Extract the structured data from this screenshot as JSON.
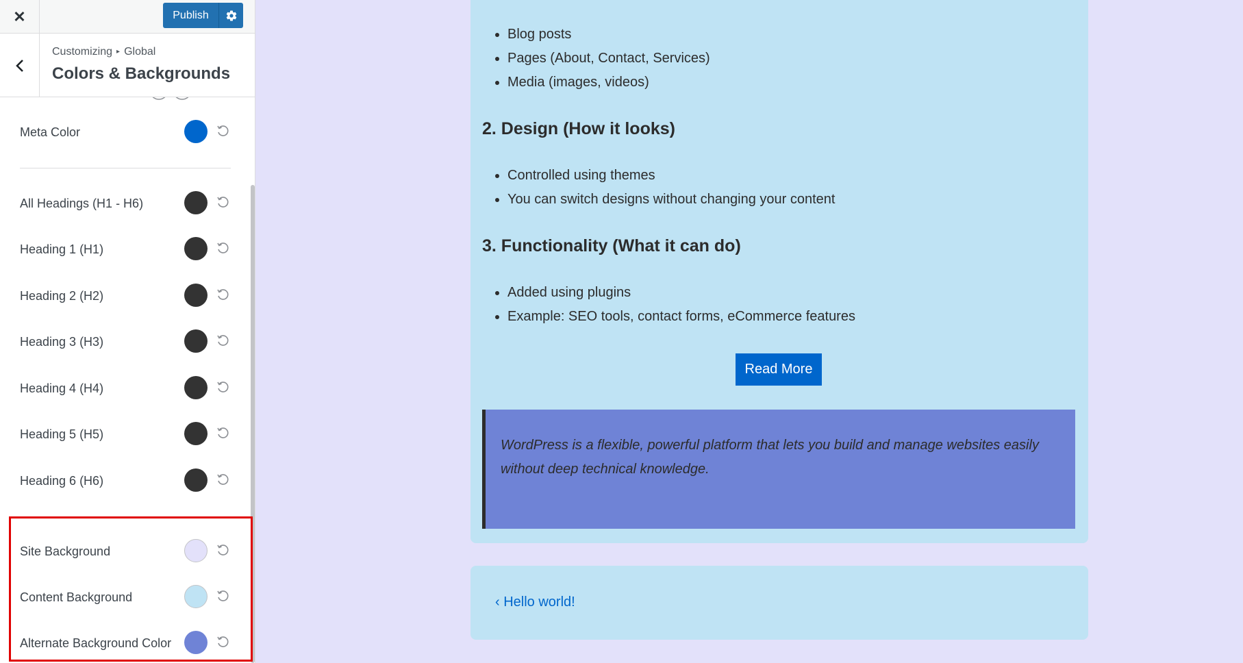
{
  "topbar": {
    "close_glyph": "✕",
    "publish_label": "Publish"
  },
  "section": {
    "breadcrumb_root": "Customizing",
    "breadcrumb_sep": "▸",
    "breadcrumb_leaf": "Global",
    "title": "Colors & Backgrounds"
  },
  "controls": [
    {
      "label": "Meta Color",
      "color": "#0066cc"
    },
    {
      "label": "All Headings (H1 - H6)",
      "color": "#333333"
    },
    {
      "label": "Heading 1 (H1)",
      "color": "#333333"
    },
    {
      "label": "Heading 2 (H2)",
      "color": "#333333"
    },
    {
      "label": "Heading 3 (H3)",
      "color": "#333333"
    },
    {
      "label": "Heading 4 (H4)",
      "color": "#333333"
    },
    {
      "label": "Heading 5 (H5)",
      "color": "#333333"
    },
    {
      "label": "Heading 6 (H6)",
      "color": "#333333"
    },
    {
      "label": "Site Background",
      "color": "#e3e1fa"
    },
    {
      "label": "Content Background",
      "color": "#bfe3f4"
    },
    {
      "label": "Alternate Background Color",
      "color": "#6f83d6"
    }
  ],
  "content": {
    "list1": [
      "Blog posts",
      "Pages (About, Contact, Services)",
      "Media (images, videos)"
    ],
    "heading2": "2. Design (How it looks)",
    "list2": [
      "Controlled using themes",
      "You can switch designs without changing your content"
    ],
    "heading3": "3. Functionality (What it can do)",
    "list3": [
      "Added using plugins",
      "Example: SEO tools, contact forms, eCommerce features"
    ],
    "read_more": "Read More",
    "quote": "WordPress is a flexible, powerful platform that lets you build and manage websites easily without deep technical knowledge.",
    "prev_post": "‹ Hello world!"
  },
  "colors": {
    "accent": "#2271b1",
    "link": "#0066cc",
    "highlight": "#e00000"
  }
}
